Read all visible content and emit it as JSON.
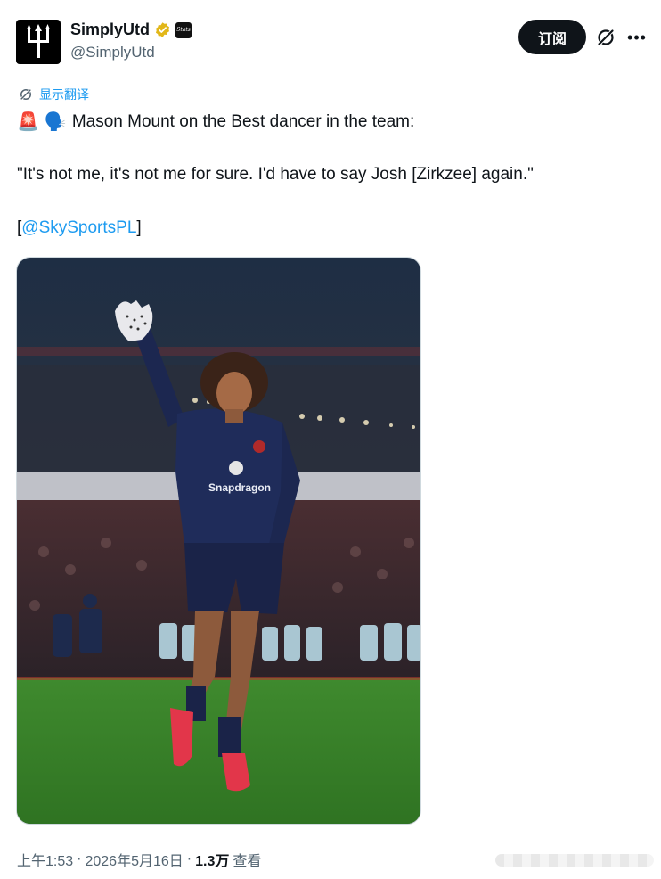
{
  "author": {
    "display_name": "SimplyUtd",
    "handle": "@SimplyUtd",
    "affiliate_badge_text": "Stats"
  },
  "actions": {
    "subscribe_label": "订阅"
  },
  "translate_label": "显示翻译",
  "tweet": {
    "emoji_1": "🚨",
    "emoji_2": "🗣️",
    "line1": "Mason Mount on the Best dancer in the team:",
    "quote": "\"It's not me, it's not me for sure. I'd have to say Josh [Zirkzee] again.\"",
    "mention_open": "[",
    "mention": "@SkySportsPL",
    "mention_close": "]"
  },
  "photo": {
    "shirt_sponsor": "Snapdragon"
  },
  "footer": {
    "time": "上午1:53",
    "sep1": "·",
    "date": "2026年5月16日",
    "sep2": "·",
    "views": "1.3万",
    "views_label": "查看"
  },
  "colors": {
    "accent": "#1d9bf0",
    "text": "#0f1419",
    "muted": "#536471",
    "verified_gold": "#e2b719"
  }
}
